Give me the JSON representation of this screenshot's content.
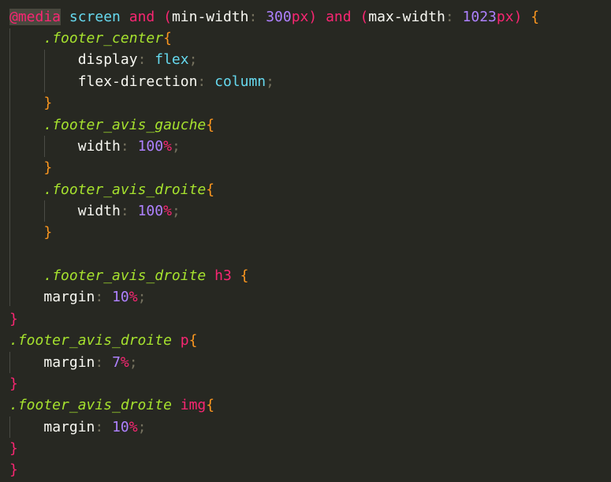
{
  "editor": {
    "language": "CSS",
    "theme_colors": {
      "background": "#272822",
      "keyword": "#f92672",
      "selector": "#a6e22e",
      "number": "#ae81ff",
      "value": "#66d9ef",
      "brace": "#fd971f"
    },
    "lines": [
      {
        "tokens": [
          {
            "t": "@media",
            "c": "at"
          },
          {
            "t": " ",
            "c": "punc"
          },
          {
            "t": "screen",
            "c": "type"
          },
          {
            "t": " ",
            "c": "punc"
          },
          {
            "t": "and",
            "c": "kw"
          },
          {
            "t": " ",
            "c": "punc"
          },
          {
            "t": "(",
            "c": "bracket"
          },
          {
            "t": "min-width",
            "c": "prop"
          },
          {
            "t": ":",
            "c": "col"
          },
          {
            "t": " ",
            "c": "punc"
          },
          {
            "t": "300",
            "c": "num"
          },
          {
            "t": "px",
            "c": "unit"
          },
          {
            "t": ")",
            "c": "bracket"
          },
          {
            "t": " ",
            "c": "punc"
          },
          {
            "t": "and",
            "c": "kw"
          },
          {
            "t": " ",
            "c": "punc"
          },
          {
            "t": "(",
            "c": "bracket"
          },
          {
            "t": "max-width",
            "c": "prop"
          },
          {
            "t": ":",
            "c": "col"
          },
          {
            "t": " ",
            "c": "punc"
          },
          {
            "t": "1023",
            "c": "num"
          },
          {
            "t": "px",
            "c": "unit"
          },
          {
            "t": ")",
            "c": "bracket"
          },
          {
            "t": " ",
            "c": "punc"
          },
          {
            "t": "{",
            "c": "brace"
          }
        ]
      },
      {
        "tokens": [
          {
            "t": "    ",
            "c": "punc"
          },
          {
            "t": ".footer_center",
            "c": "sel"
          },
          {
            "t": "{",
            "c": "brace"
          }
        ]
      },
      {
        "tokens": [
          {
            "t": "        ",
            "c": "punc"
          },
          {
            "t": "display",
            "c": "prop"
          },
          {
            "t": ":",
            "c": "col"
          },
          {
            "t": " ",
            "c": "punc"
          },
          {
            "t": "flex",
            "c": "val"
          },
          {
            "t": ";",
            "c": "col"
          }
        ]
      },
      {
        "tokens": [
          {
            "t": "        ",
            "c": "punc"
          },
          {
            "t": "flex-direction",
            "c": "prop"
          },
          {
            "t": ":",
            "c": "col"
          },
          {
            "t": " ",
            "c": "punc"
          },
          {
            "t": "column",
            "c": "val"
          },
          {
            "t": ";",
            "c": "col"
          }
        ]
      },
      {
        "tokens": [
          {
            "t": "    ",
            "c": "punc"
          },
          {
            "t": "}",
            "c": "brace"
          }
        ]
      },
      {
        "tokens": [
          {
            "t": "    ",
            "c": "punc"
          },
          {
            "t": ".footer_avis_gauche",
            "c": "sel"
          },
          {
            "t": "{",
            "c": "brace"
          }
        ]
      },
      {
        "tokens": [
          {
            "t": "        ",
            "c": "punc"
          },
          {
            "t": "width",
            "c": "prop"
          },
          {
            "t": ":",
            "c": "col"
          },
          {
            "t": " ",
            "c": "punc"
          },
          {
            "t": "100",
            "c": "num"
          },
          {
            "t": "%",
            "c": "unit"
          },
          {
            "t": ";",
            "c": "col"
          }
        ]
      },
      {
        "tokens": [
          {
            "t": "    ",
            "c": "punc"
          },
          {
            "t": "}",
            "c": "brace"
          }
        ]
      },
      {
        "tokens": [
          {
            "t": "    ",
            "c": "punc"
          },
          {
            "t": ".footer_avis_droite",
            "c": "sel"
          },
          {
            "t": "{",
            "c": "brace"
          }
        ]
      },
      {
        "tokens": [
          {
            "t": "        ",
            "c": "punc"
          },
          {
            "t": "width",
            "c": "prop"
          },
          {
            "t": ":",
            "c": "col"
          },
          {
            "t": " ",
            "c": "punc"
          },
          {
            "t": "100",
            "c": "num"
          },
          {
            "t": "%",
            "c": "unit"
          },
          {
            "t": ";",
            "c": "col"
          }
        ]
      },
      {
        "tokens": [
          {
            "t": "    ",
            "c": "punc"
          },
          {
            "t": "}",
            "c": "brace"
          }
        ]
      },
      {
        "tokens": []
      },
      {
        "tokens": [
          {
            "t": "    ",
            "c": "punc"
          },
          {
            "t": ".footer_avis_droite",
            "c": "sel"
          },
          {
            "t": " ",
            "c": "punc"
          },
          {
            "t": "h3",
            "c": "tag"
          },
          {
            "t": " ",
            "c": "punc"
          },
          {
            "t": "{",
            "c": "brace"
          }
        ]
      },
      {
        "tokens": [
          {
            "t": "    ",
            "c": "punc"
          },
          {
            "t": "margin",
            "c": "prop"
          },
          {
            "t": ":",
            "c": "col"
          },
          {
            "t": " ",
            "c": "punc"
          },
          {
            "t": "10",
            "c": "num"
          },
          {
            "t": "%",
            "c": "unit"
          },
          {
            "t": ";",
            "c": "col"
          }
        ]
      },
      {
        "tokens": [
          {
            "t": "}",
            "c": "bracket"
          }
        ]
      },
      {
        "tokens": [
          {
            "t": ".footer_avis_droite",
            "c": "sel"
          },
          {
            "t": " ",
            "c": "punc"
          },
          {
            "t": "p",
            "c": "tag"
          },
          {
            "t": "{",
            "c": "brace"
          }
        ]
      },
      {
        "tokens": [
          {
            "t": "    ",
            "c": "punc"
          },
          {
            "t": "margin",
            "c": "prop"
          },
          {
            "t": ":",
            "c": "col"
          },
          {
            "t": " ",
            "c": "punc"
          },
          {
            "t": "7",
            "c": "num"
          },
          {
            "t": "%",
            "c": "unit"
          },
          {
            "t": ";",
            "c": "col"
          }
        ]
      },
      {
        "tokens": [
          {
            "t": "}",
            "c": "bracket"
          }
        ]
      },
      {
        "tokens": [
          {
            "t": ".footer_avis_droite",
            "c": "sel"
          },
          {
            "t": " ",
            "c": "punc"
          },
          {
            "t": "img",
            "c": "tag"
          },
          {
            "t": "{",
            "c": "brace"
          }
        ]
      },
      {
        "tokens": [
          {
            "t": "    ",
            "c": "punc"
          },
          {
            "t": "margin",
            "c": "prop"
          },
          {
            "t": ":",
            "c": "col"
          },
          {
            "t": " ",
            "c": "punc"
          },
          {
            "t": "10",
            "c": "num"
          },
          {
            "t": "%",
            "c": "unit"
          },
          {
            "t": ";",
            "c": "col"
          }
        ]
      },
      {
        "tokens": [
          {
            "t": "}",
            "c": "bracket"
          }
        ]
      },
      {
        "tokens": [
          {
            "t": "}",
            "c": "bracket"
          }
        ]
      }
    ]
  }
}
